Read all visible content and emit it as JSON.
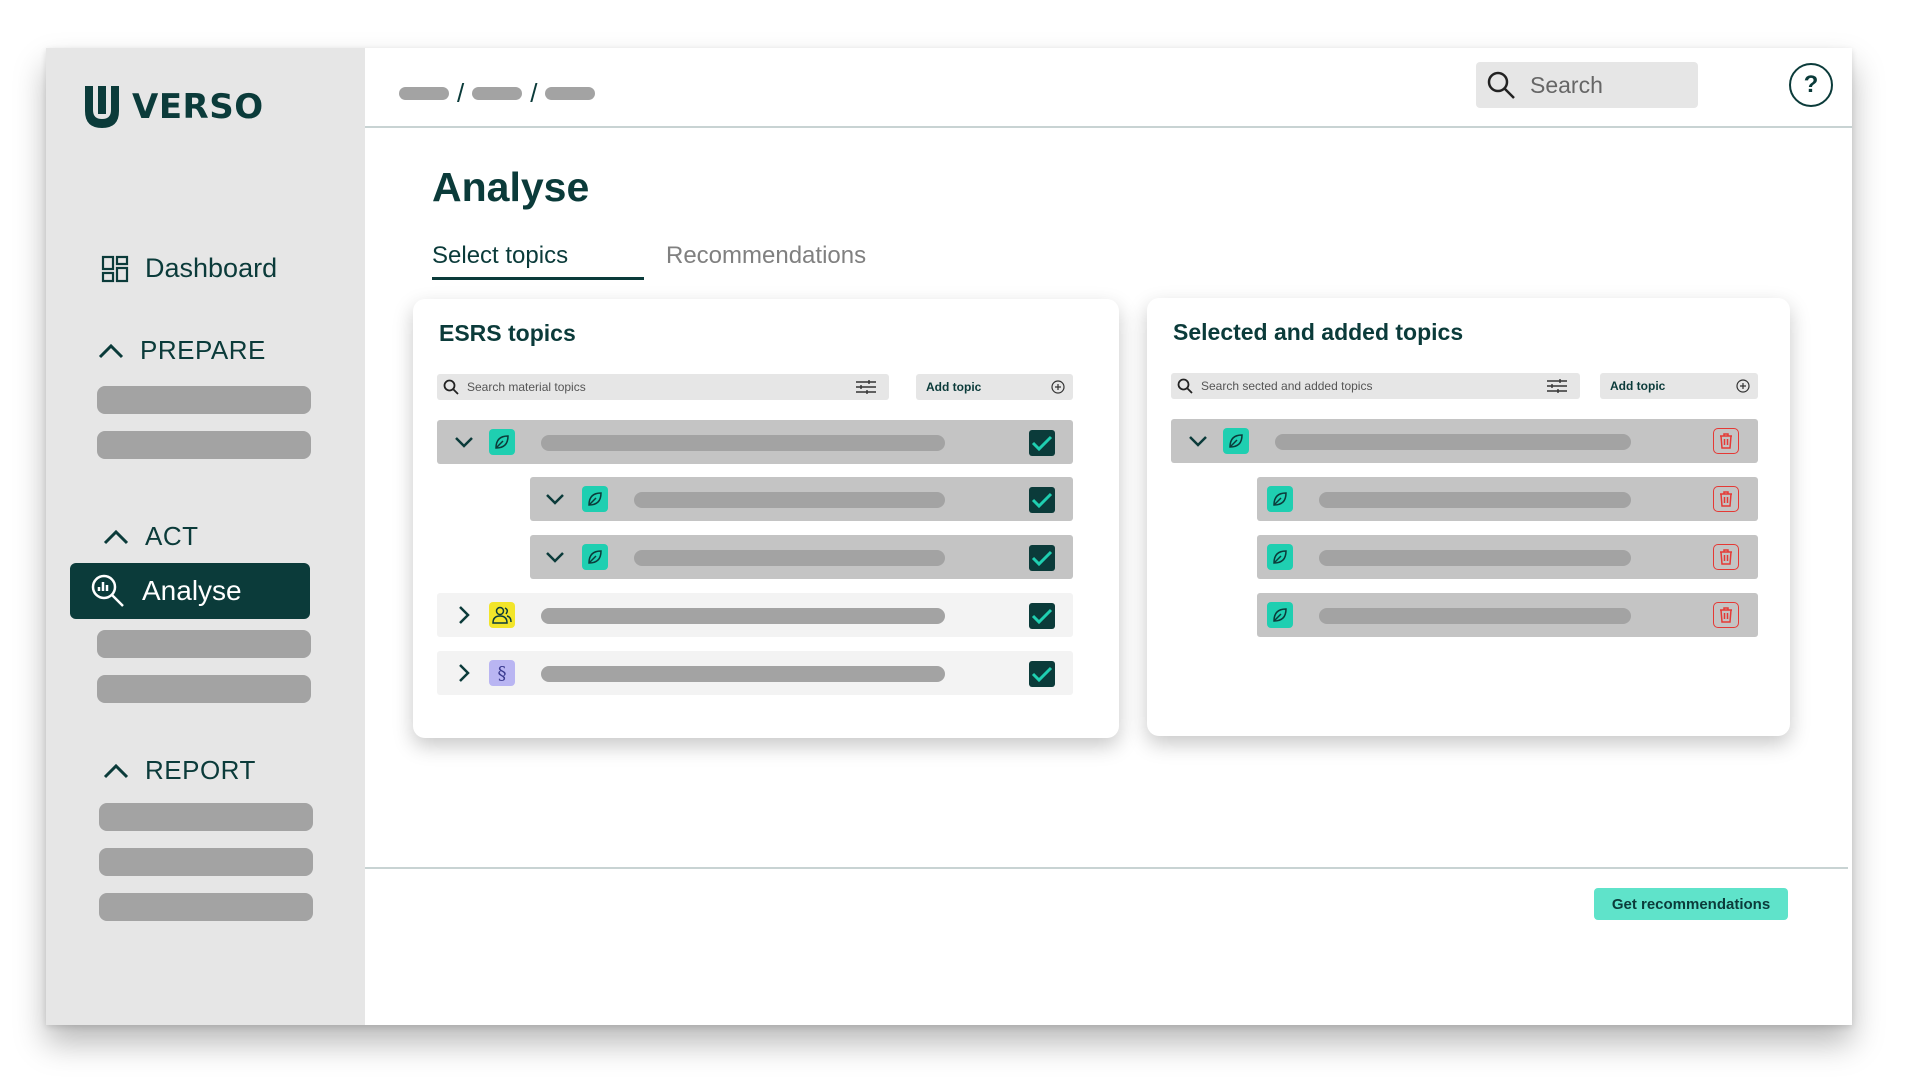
{
  "app": {
    "logo_text": "VERSO"
  },
  "topbar": {
    "search_placeholder": "Search",
    "help_label": "?"
  },
  "sidebar": {
    "dashboard_label": "Dashboard",
    "sections": {
      "prepare": "PREPARE",
      "act": "ACT",
      "report": "REPORT"
    },
    "active_item": "Analyse"
  },
  "main": {
    "title": "Analyse",
    "tabs": [
      {
        "label": "Select topics",
        "active": true
      },
      {
        "label": "Recommendations",
        "active": false
      }
    ],
    "esrs_card": {
      "title": "ESRS topics",
      "search_placeholder": "Search material topics",
      "add_label": "Add topic"
    },
    "selected_card": {
      "title": "Selected and added topics",
      "search_placeholder": "Search sected and added topics",
      "add_label": "Add topic"
    },
    "primary_action": "Get recommendations"
  },
  "icons": {
    "environment": "leaf-icon",
    "social": "people-icon",
    "governance": "section-sign-icon",
    "paragraph_glyph": "§"
  },
  "colors": {
    "brand": "#0b3b3a",
    "accent": "#5fe3ca",
    "leaf": "#1fcfb1",
    "social": "#f2e52a",
    "governance": "#b9b5f2",
    "delete": "#e53935"
  }
}
